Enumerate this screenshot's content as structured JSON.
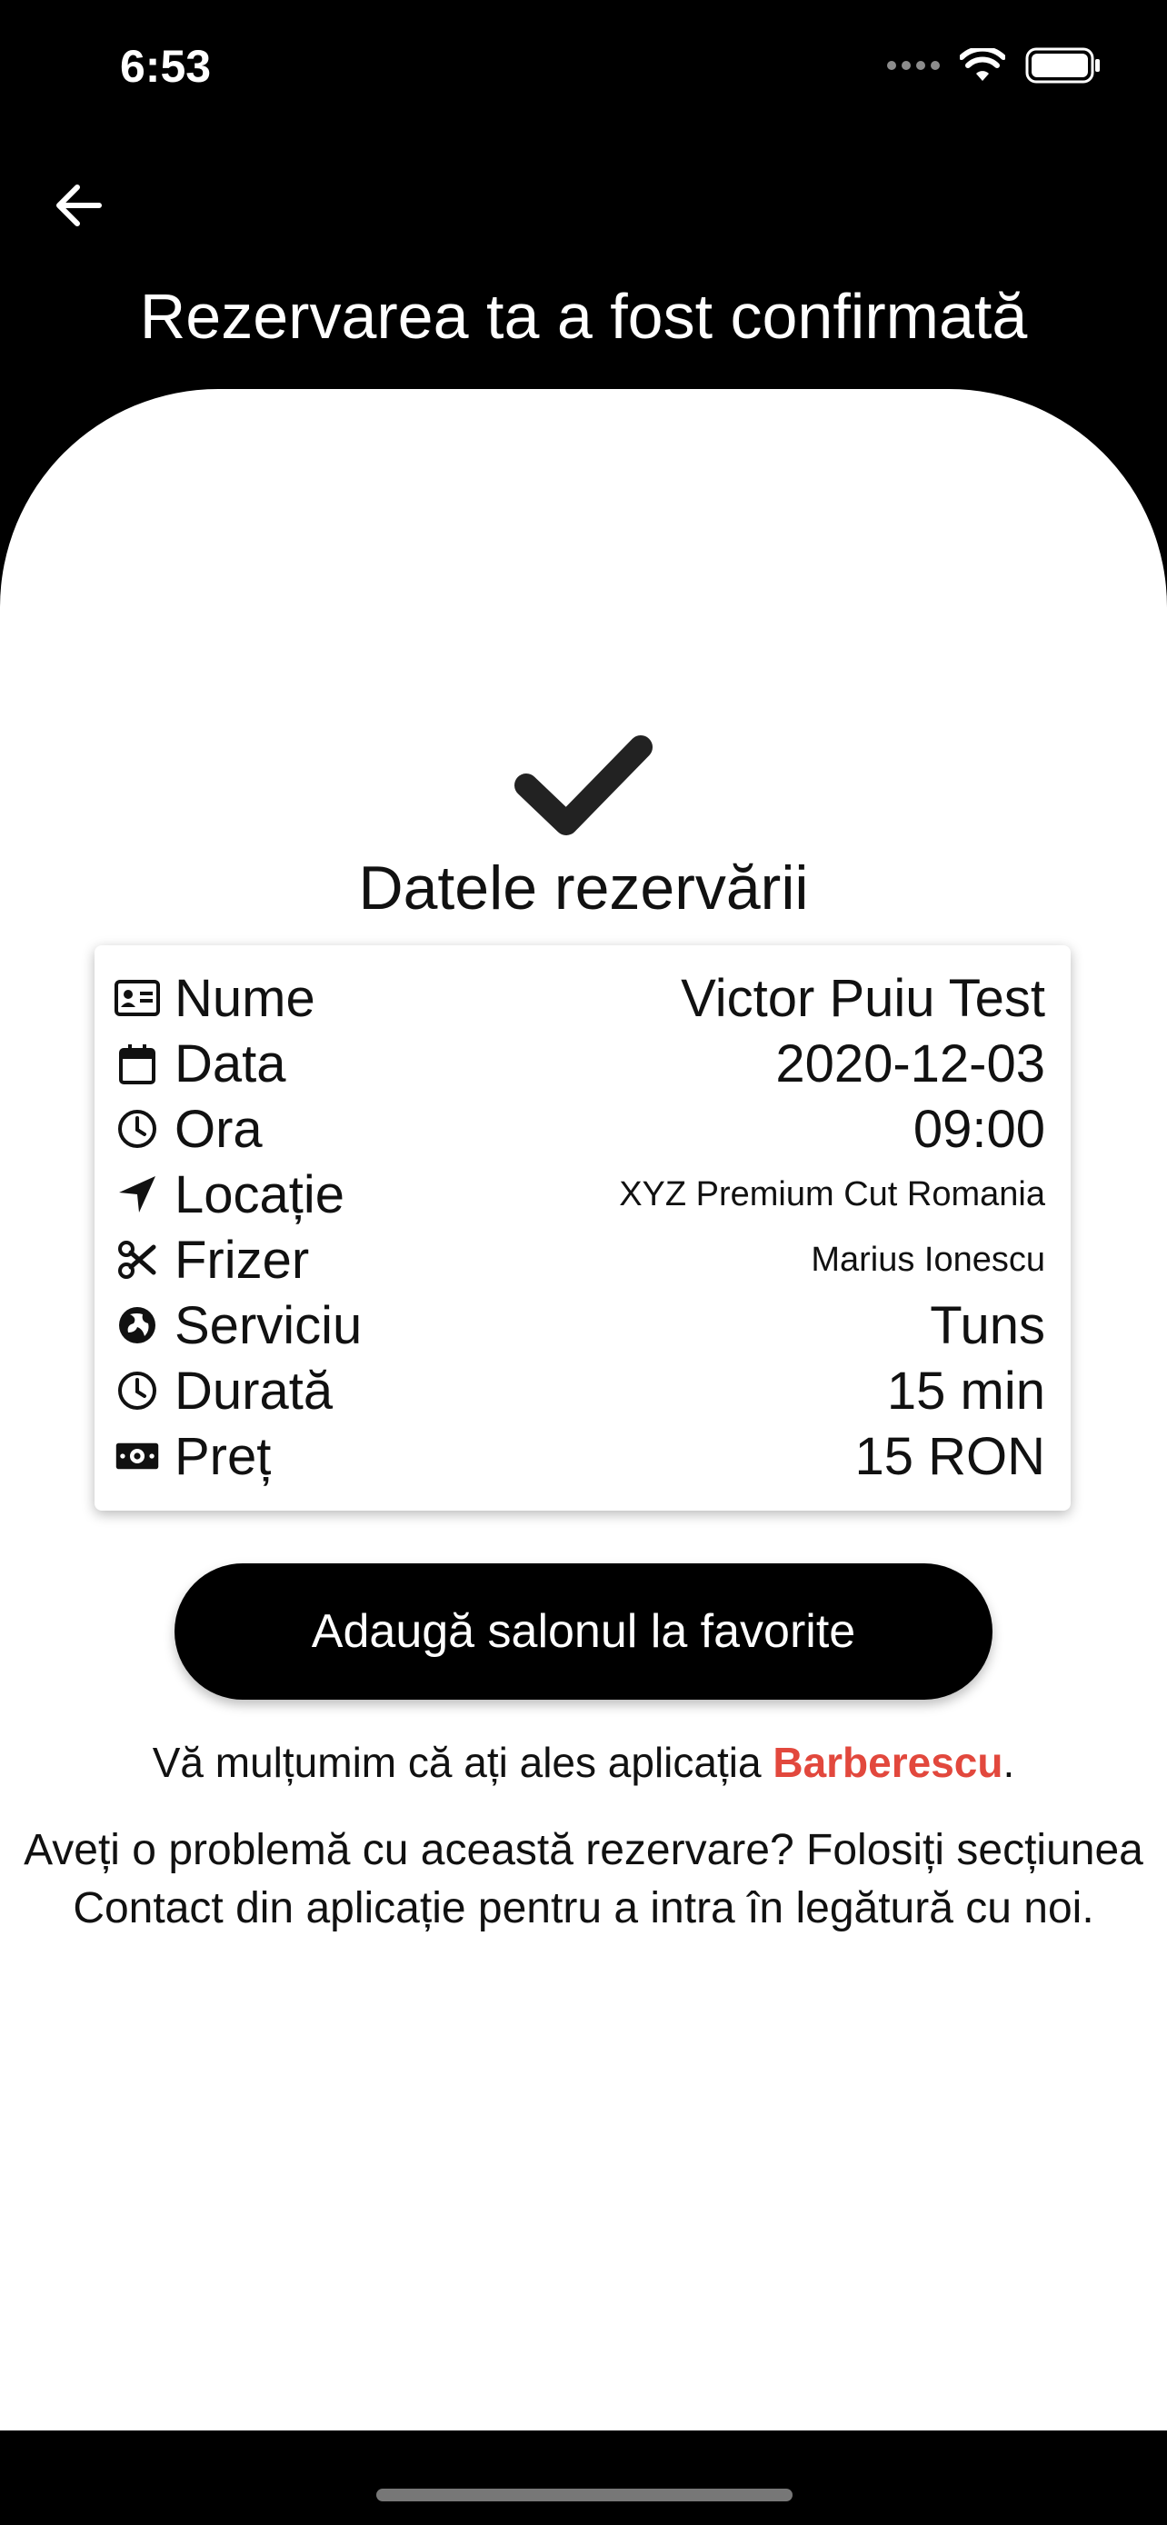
{
  "status_bar": {
    "time": "6:53"
  },
  "header": {
    "title": "Rezervarea ta a fost confirmată"
  },
  "section_title": "Datele rezervării",
  "details": [
    {
      "icon": "id-card-icon",
      "label": "Nume",
      "value": "Victor Puiu Test"
    },
    {
      "icon": "calendar-icon",
      "label": "Data",
      "value": "2020-12-03"
    },
    {
      "icon": "clock-icon",
      "label": "Ora",
      "value": "09:00"
    },
    {
      "icon": "location-arrow-icon",
      "label": "Locație",
      "value": "XYZ Premium Cut Romania"
    },
    {
      "icon": "scissors-icon",
      "label": "Frizer",
      "value": "Marius Ionescu"
    },
    {
      "icon": "globe-icon",
      "label": "Serviciu",
      "value": "Tuns"
    },
    {
      "icon": "clock-icon",
      "label": "Durată",
      "value": "15 min"
    },
    {
      "icon": "money-bill-icon",
      "label": "Preț",
      "value": "15 RON"
    }
  ],
  "favorite_button_label": "Adaugă salonul la favorite",
  "thanks": {
    "prefix": "Vă mulțumim că ați ales aplicația ",
    "brand": "Barberescu",
    "suffix": "."
  },
  "help_text": "Aveți o problemă cu această rezervare? Folosiți secțiunea Contact din aplicație pentru a intra în legătură cu noi.",
  "colors": {
    "brand": "#e2483d",
    "background": "#000000",
    "card": "#ffffff"
  }
}
